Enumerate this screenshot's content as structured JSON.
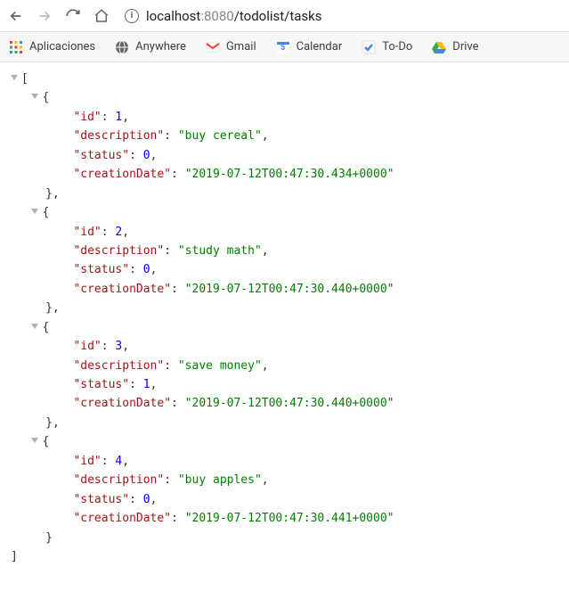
{
  "toolbar": {
    "url_host": "localhost",
    "url_port": ":8080",
    "url_path": "/todolist/tasks"
  },
  "bookmarks": {
    "apps": "Aplicaciones",
    "anywhere": "Anywhere",
    "gmail": "Gmail",
    "calendar": "Calendar",
    "calendar_day": "5",
    "todo": "To-Do",
    "drive": "Drive"
  },
  "json": {
    "keys": {
      "id": "\"id\"",
      "description": "\"description\"",
      "status": "\"status\"",
      "creationDate": "\"creationDate\""
    },
    "items": [
      {
        "id": "1",
        "description": "\"buy cereal\"",
        "status": "0",
        "creationDate": "\"2019-07-12T00:47:30.434+0000\""
      },
      {
        "id": "2",
        "description": "\"study math\"",
        "status": "0",
        "creationDate": "\"2019-07-12T00:47:30.440+0000\""
      },
      {
        "id": "3",
        "description": "\"save money\"",
        "status": "1",
        "creationDate": "\"2019-07-12T00:47:30.440+0000\""
      },
      {
        "id": "4",
        "description": "\"buy apples\"",
        "status": "0",
        "creationDate": "\"2019-07-12T00:47:30.441+0000\""
      }
    ]
  }
}
